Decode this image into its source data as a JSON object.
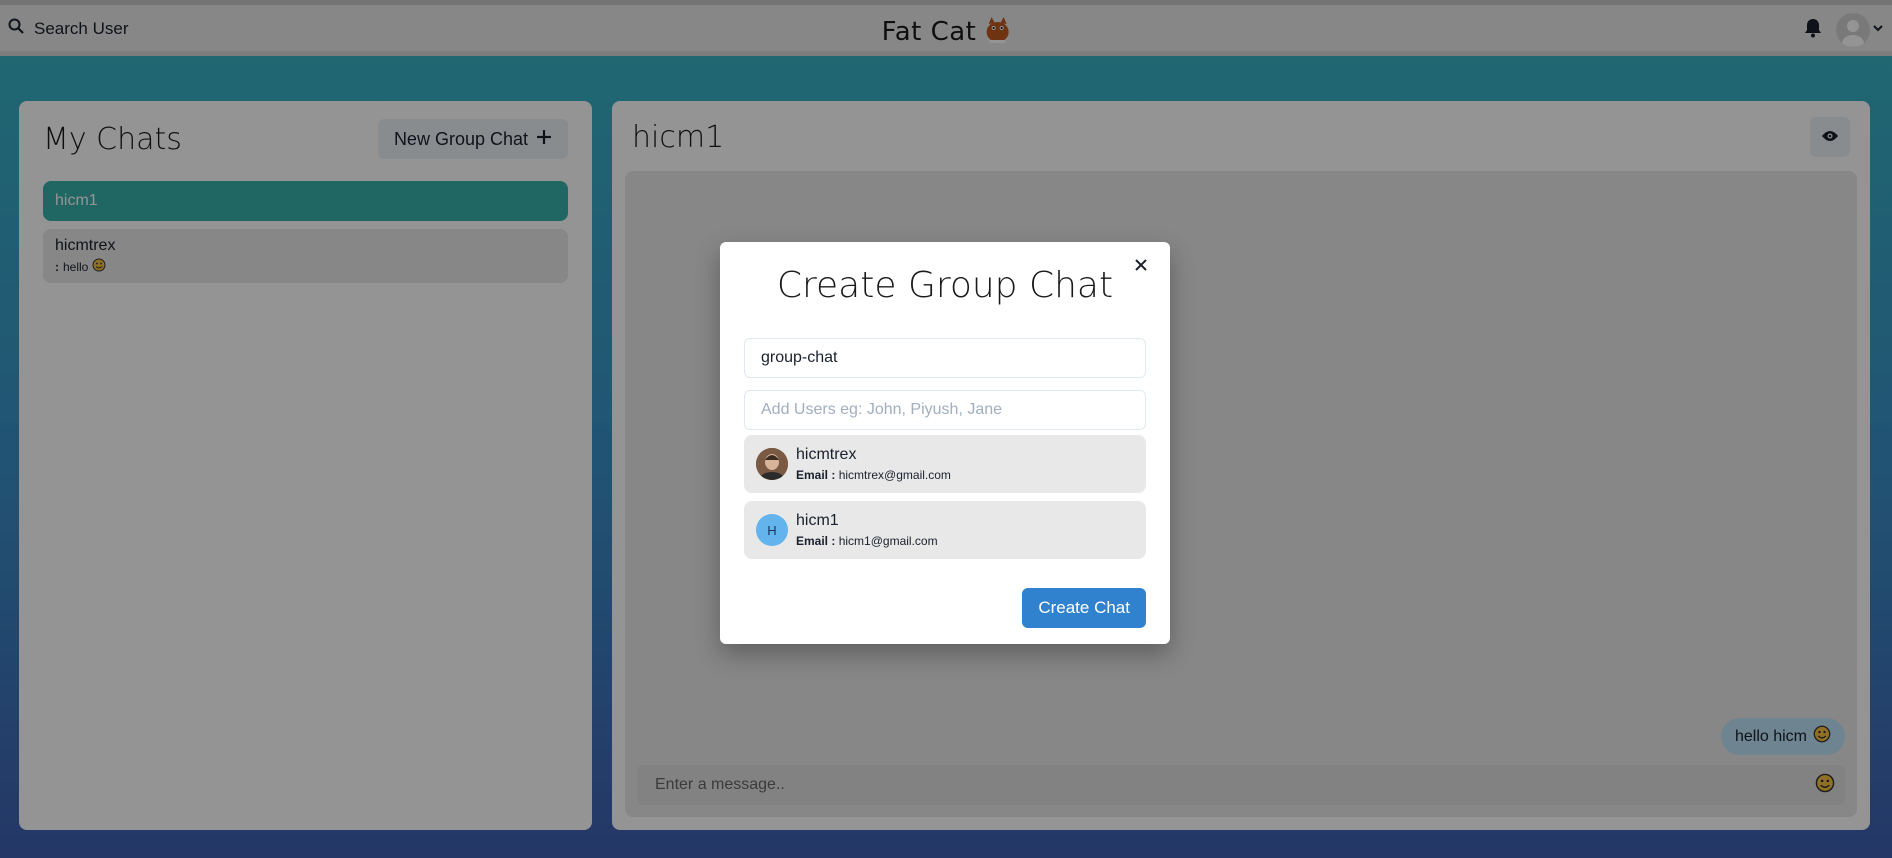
{
  "header": {
    "search_label": "Search User",
    "app_title": "Fat Cat"
  },
  "my_chats": {
    "title": "My Chats",
    "new_group_label": "New Group Chat",
    "items": [
      {
        "name": "hicm1",
        "active": true
      },
      {
        "name": "hicmtrex",
        "latest_sender": ":",
        "latest_text": "hello",
        "active": false
      }
    ]
  },
  "chat": {
    "title": "hicm1",
    "messages": [
      {
        "text": "hello hicm"
      }
    ],
    "input_placeholder": "Enter a message.."
  },
  "modal": {
    "title": "Create Group Chat",
    "chat_name_value": "group-chat",
    "users_placeholder": "Add Users eg: John, Piyush, Jane",
    "results": [
      {
        "name": "hicmtrex",
        "email_label": "Email :",
        "email": "hicmtrex@gmail.com",
        "avatar": "photo"
      },
      {
        "name": "hicm1",
        "email_label": "Email :",
        "email": "hicm1@gmail.com",
        "avatar_initial": "H"
      }
    ],
    "create_label": "Create Chat"
  },
  "colors": {
    "active_chat": "#38b2ac",
    "primary_button": "#3182ce",
    "message_bubble": "#bee3f8"
  }
}
